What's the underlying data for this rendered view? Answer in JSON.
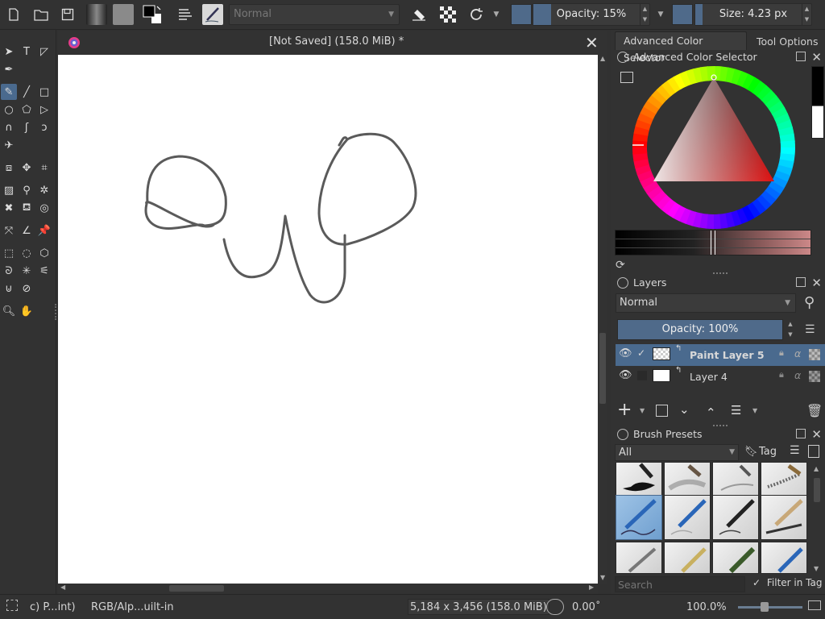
{
  "toolbar": {
    "blend_mode": "Normal",
    "opacity_label": "Opacity: 15%",
    "opacity_fraction": 0.15,
    "size_label": "Size: 4.23 px",
    "size_fraction": 0.06
  },
  "document": {
    "title": "[Not Saved]  (158.0 MiB) *"
  },
  "docker": {
    "tabs": [
      "Advanced Color Selector",
      "Tool Options"
    ],
    "color_selector_title": "Advanced Color Selector",
    "layers_title": "Layers",
    "layers_blend_mode": "Normal",
    "layers_opacity": "Opacity:  100%",
    "layers": [
      {
        "name": "Paint Layer 5",
        "selected": true
      },
      {
        "name": "Layer 4",
        "selected": false
      }
    ],
    "brush_presets_title": "Brush Presets",
    "brush_filter": "All",
    "tag_label": "Tag",
    "search_placeholder": "Search",
    "filter_in_tag": "Filter in Tag"
  },
  "status": {
    "brush": "c) P...int)",
    "color_space": "RGB/Alp...uilt-in",
    "dimensions": "5,184 x 3,456 (158.0 MiB)",
    "rotation": "0.00˚",
    "zoom": "100.0%"
  },
  "colors": {
    "accent": "#4f6a8a",
    "selection": "#4a6a8e",
    "panel": "#323232",
    "canvas": "#ffffff"
  }
}
